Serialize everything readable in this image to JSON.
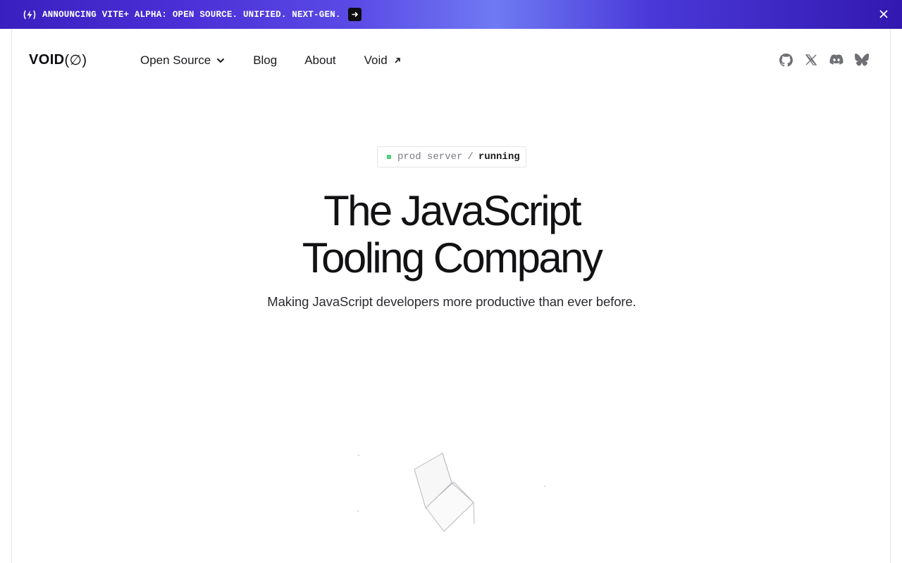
{
  "banner": {
    "text": "ANNOUNCING VITE+ ALPHA: OPEN SOURCE. UNIFIED. NEXT-GEN.",
    "icon": "vite-bolt-icon",
    "arrow_icon": "arrow-right-icon",
    "close_icon": "close-icon"
  },
  "header": {
    "logo_main": "VOID",
    "logo_symbol": "(∅)",
    "nav": [
      {
        "label": "Open Source",
        "icon": "chevron-down-icon"
      },
      {
        "label": "Blog"
      },
      {
        "label": "About"
      },
      {
        "label": "Void",
        "icon": "external-link-icon"
      }
    ],
    "social": [
      "github-icon",
      "x-icon",
      "discord-icon",
      "bluesky-icon"
    ]
  },
  "hero": {
    "badge_label": "prod server",
    "badge_separator": "/",
    "badge_status": "running",
    "title_line1": "The JavaScript",
    "title_line2": "Tooling Company",
    "subtitle": "Making JavaScript developers more productive than ever before."
  },
  "colors": {
    "banner_start": "#3a1fbf",
    "banner_end": "#3218b0",
    "status_green": "#4fd17a",
    "text": "#121214"
  }
}
